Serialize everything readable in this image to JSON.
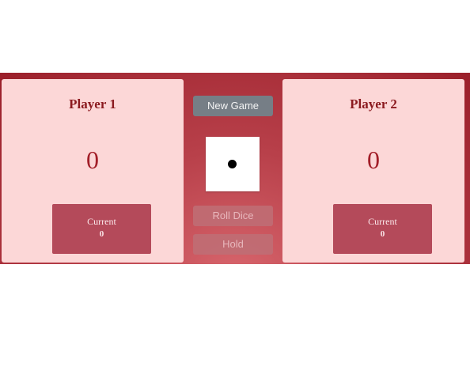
{
  "player1": {
    "name": "Player 1",
    "score": "0",
    "current_label": "Current",
    "current_score": "0"
  },
  "player2": {
    "name": "Player 2",
    "score": "0",
    "current_label": "Current",
    "current_score": "0"
  },
  "controls": {
    "new_game": "New Game",
    "roll_dice": "Roll Dice",
    "hold": "Hold"
  },
  "dice": {
    "value": 1
  },
  "colors": {
    "panel_bg": "#fcd7d7",
    "accent_dark_red": "#8b1a1f",
    "current_box": "#b44a5a",
    "new_game_button": "#767e86"
  }
}
